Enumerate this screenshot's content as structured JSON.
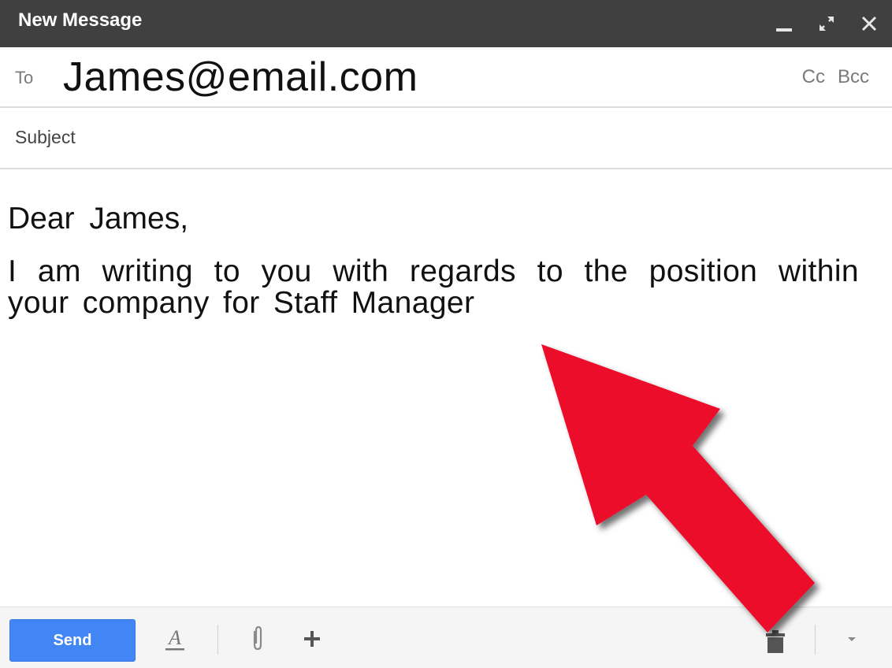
{
  "window": {
    "title": "New Message"
  },
  "icons": {
    "minimize": "minimize-icon",
    "expand": "expand-icon",
    "close": "close-icon",
    "formatting": "text-format-icon",
    "attach": "paperclip-icon",
    "insert": "plus-icon",
    "discard": "trash-icon",
    "more": "chevron-down-icon",
    "annotation": "red-arrow"
  },
  "recipients": {
    "to_label": "To",
    "to_value": "James@email.com",
    "cc_label": "Cc",
    "bcc_label": "Bcc"
  },
  "subject": {
    "placeholder": "Subject"
  },
  "body": {
    "greeting": "Dear James,",
    "paragraph": "I am writing to you with regards to the position within your company for Staff Manager"
  },
  "toolbar": {
    "send_label": "Send",
    "format_glyph": "A"
  },
  "colors": {
    "titlebar": "#404040",
    "send_button": "#4285f4",
    "arrow": "#ec0a2b"
  }
}
